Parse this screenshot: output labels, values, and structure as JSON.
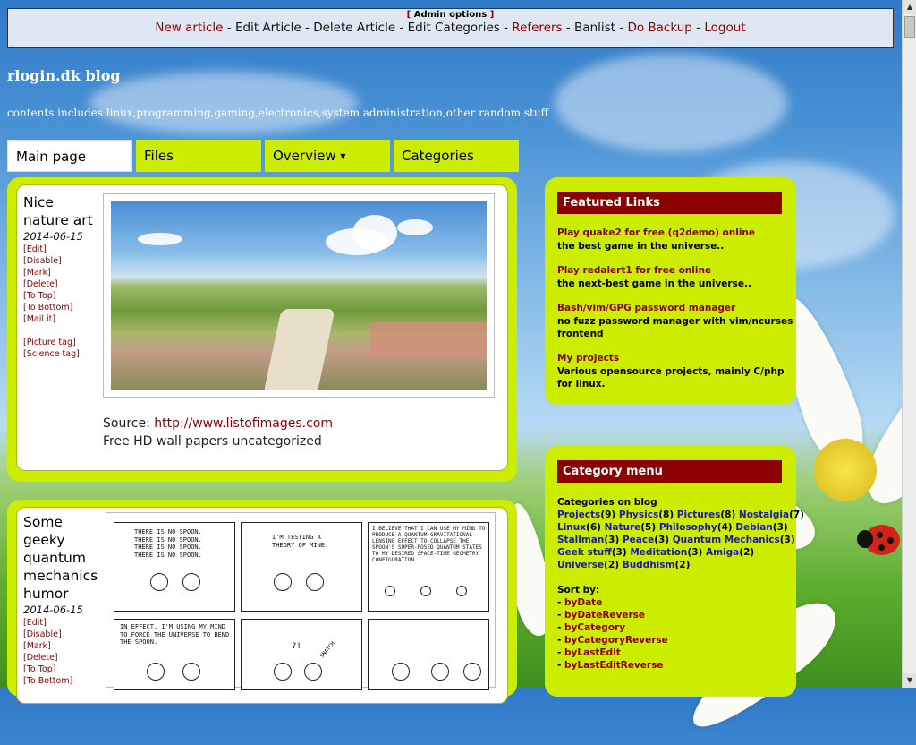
{
  "admin": {
    "title": "Admin options",
    "links": [
      {
        "label": "New article",
        "style": "red"
      },
      {
        "label": "Edit Article",
        "style": "black"
      },
      {
        "label": "Delete Article",
        "style": "black"
      },
      {
        "label": "Edit Categories",
        "style": "black"
      },
      {
        "label": "Referers",
        "style": "red"
      },
      {
        "label": "Banlist",
        "style": "black"
      },
      {
        "label": "Do Backup",
        "style": "red"
      },
      {
        "label": "Logout",
        "style": "red"
      }
    ],
    "separator": "-"
  },
  "site": {
    "title": "rlogin.dk blog",
    "subtitle": "contents includes linux,programming,gaming,electronics,system administration,other random stuff"
  },
  "nav": {
    "tabs": [
      {
        "label": "Main page",
        "active": true
      },
      {
        "label": "Files",
        "active": false
      },
      {
        "label": "Overview",
        "active": false,
        "dropdown": "▼"
      },
      {
        "label": "Categories",
        "active": false
      }
    ]
  },
  "articles": [
    {
      "title_lines": [
        "Nice",
        "nature art"
      ],
      "date": "2014-06-15",
      "actions": [
        "[Edit]",
        "[Disable]",
        "[Mark]",
        "[Delete]",
        "[To Top]",
        "[To Bottom]",
        "[Mail it]"
      ],
      "tags": [
        "[Picture tag]",
        "[Science tag]"
      ],
      "source_label": "Source:",
      "source_url": "http://www.listofimages.com",
      "caption": "Free HD wall papers uncategorized"
    },
    {
      "title_lines": [
        "Some",
        "geeky",
        "quantum",
        "mechanics",
        "humor"
      ],
      "date": "2014-06-15",
      "actions": [
        "[Edit]",
        "[Disable]",
        "[Mark]",
        "[Delete]",
        "[To Top]",
        "[To Bottom]"
      ],
      "comic": {
        "p1": "There is no spoon. There is no spoon. There is no spoon. There is no spoon.",
        "p2": "I'm testing a theory of mine.",
        "p3": "I believe that I can use my mind to produce a quantum gravitational lensing effect to collapse the spoon's super-posed quantum states to my desired space-time geometry configuration.",
        "p4": "In effect, I'm using my mind to force the universe to bend the spoon.",
        "p5": "?!",
        "p5b": "Snatch"
      }
    }
  ],
  "featured": {
    "header": "Featured Links",
    "items": [
      {
        "title": "Play quake2 for free (q2demo) online",
        "desc": [
          "the best game in the universe.."
        ]
      },
      {
        "title": "Play redalert1 for free online",
        "desc": [
          "the next-best game in the universe.."
        ]
      },
      {
        "title": "Bash/vim/GPG password manager",
        "desc": [
          "no fuzz password manager with vim/ncurses",
          "frontend"
        ]
      },
      {
        "title": "My projects",
        "desc": [
          "Various opensource projects, mainly C/php",
          "for linux."
        ]
      }
    ]
  },
  "categories": {
    "header": "Category menu",
    "intro": "Categories on blog",
    "lines": [
      [
        [
          "Projects",
          "(9)"
        ],
        [
          "Physics",
          "(8)"
        ],
        [
          "Pictures",
          "(8)"
        ],
        [
          "Nostalgia",
          "(7)"
        ]
      ],
      [
        [
          "Linux",
          "(6)"
        ],
        [
          "Nature",
          "(5)"
        ],
        [
          "Philosophy",
          "(4)"
        ],
        [
          "Debian",
          "(3)"
        ]
      ],
      [
        [
          "Stallman",
          "(3)"
        ],
        [
          "Peace",
          "(3)"
        ],
        [
          "Quantum Mechanics",
          "(3)"
        ]
      ],
      [
        [
          "Geek stuff",
          "(3)"
        ],
        [
          "Meditation",
          "(3)"
        ],
        [
          "Amiga",
          "(2)"
        ]
      ],
      [
        [
          "Universe",
          "(2)"
        ],
        [
          "Buddhism",
          "(2)"
        ]
      ]
    ],
    "sort_label": "Sort by:",
    "sort_items": [
      "byDate",
      "byDateReverse",
      "byCategory",
      "byCategoryReverse",
      "byLastEdit",
      "byLastEditReverse"
    ]
  }
}
